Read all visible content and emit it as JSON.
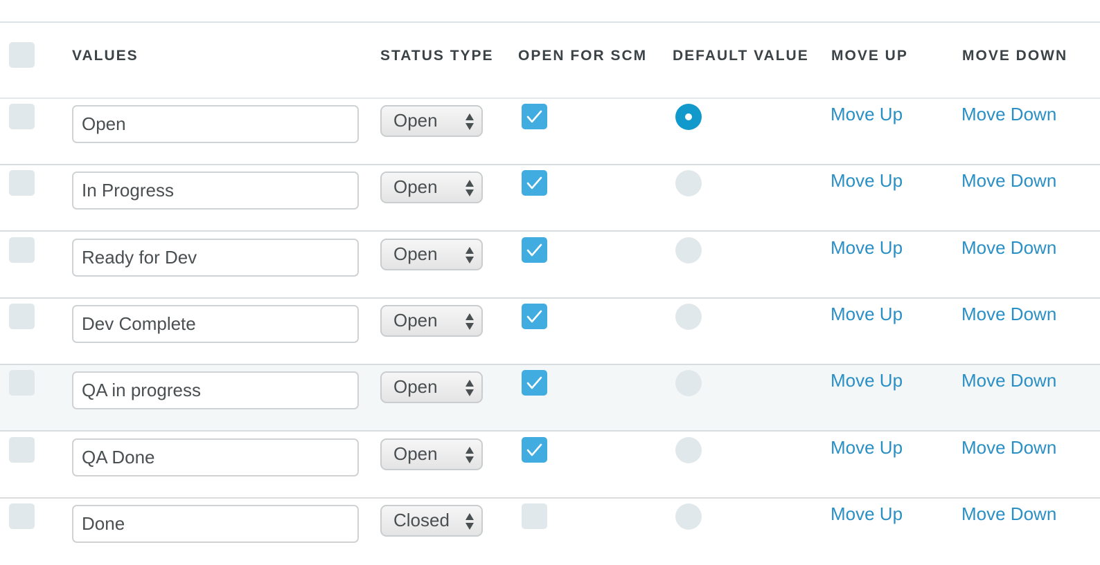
{
  "table": {
    "headers": {
      "values": "VALUES",
      "status_type": "STATUS TYPE",
      "open_for_scm": "OPEN FOR SCM",
      "default_value": "DEFAULT VALUE",
      "move_up": "MOVE UP",
      "move_down": "MOVE DOWN"
    },
    "colors": {
      "accent": "#1199cc",
      "checkbox_checked": "#40ace0",
      "link": "#2a8fc4",
      "row_highlight": "#f4f7f8"
    },
    "rows": [
      {
        "value": "Open",
        "status_type": "Open",
        "open_for_scm": true,
        "default": true,
        "move_up": "Move Up",
        "move_down": "Move Down"
      },
      {
        "value": "In Progress",
        "status_type": "Open",
        "open_for_scm": true,
        "default": false,
        "move_up": "Move Up",
        "move_down": "Move Down"
      },
      {
        "value": "Ready for Dev",
        "status_type": "Open",
        "open_for_scm": true,
        "default": false,
        "move_up": "Move Up",
        "move_down": "Move Down"
      },
      {
        "value": "Dev Complete",
        "status_type": "Open",
        "open_for_scm": true,
        "default": false,
        "move_up": "Move Up",
        "move_down": "Move Down"
      },
      {
        "value": "QA in progress",
        "status_type": "Open",
        "open_for_scm": true,
        "default": false,
        "highlighted": true,
        "move_up": "Move Up",
        "move_down": "Move Down"
      },
      {
        "value": "QA Done",
        "status_type": "Open",
        "open_for_scm": true,
        "default": false,
        "move_up": "Move Up",
        "move_down": "Move Down"
      },
      {
        "value": "Done",
        "status_type": "Closed",
        "open_for_scm": false,
        "default": false,
        "move_up": "Move Up",
        "move_down": "Move Down"
      }
    ]
  }
}
